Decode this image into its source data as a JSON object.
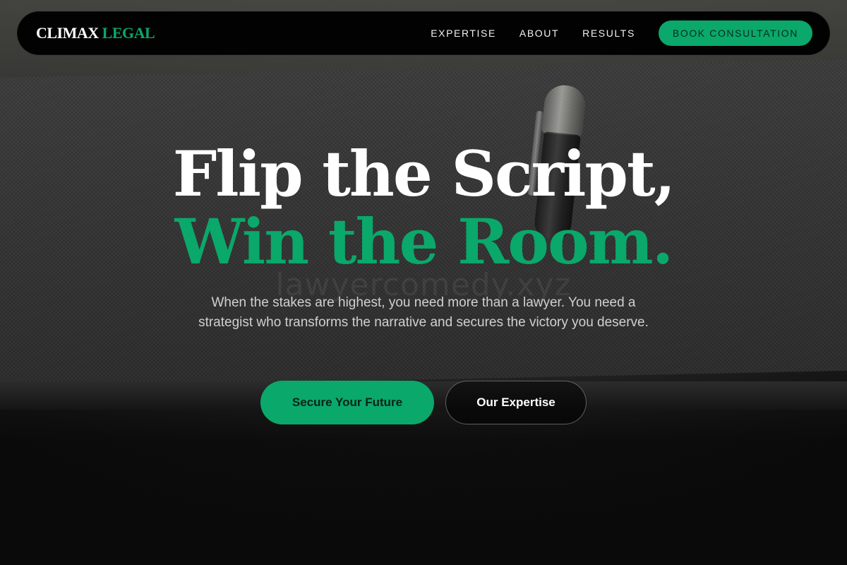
{
  "brand": {
    "name_primary": "CLIMAX",
    "name_accent": "LEGAL"
  },
  "nav": {
    "links": [
      {
        "label": "EXPERTISE"
      },
      {
        "label": "ABOUT"
      },
      {
        "label": "RESULTS"
      }
    ],
    "cta_label": "BOOK CONSULTATION"
  },
  "hero": {
    "headline_line1": "Flip the Script,",
    "headline_line2": "Win the Room.",
    "subheadline": "When the stakes are highest, you need more than a lawyer. You need a strategist who transforms the narrative and secures the victory you deserve.",
    "primary_button": "Secure Your Future",
    "secondary_button": "Our Expertise"
  },
  "watermark": "lawyercomedy.xyz",
  "colors": {
    "accent": "#0aa86a",
    "nav_bg": "#020202",
    "page_bg": "#0b0b0b"
  }
}
